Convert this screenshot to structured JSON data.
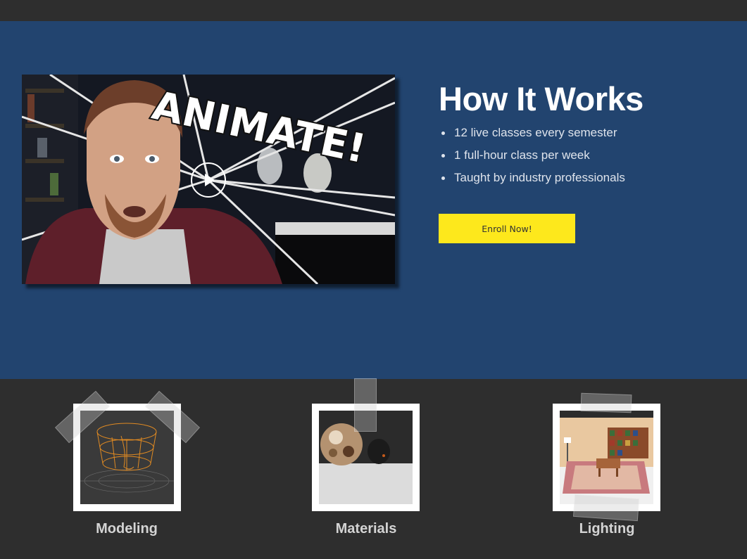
{
  "video": {
    "overlay_text": "ANIMATE!",
    "play_icon": "play-icon"
  },
  "how_it_works": {
    "title": "How It Works",
    "features": [
      "12 live classes every semester",
      "1 full-hour class per week",
      "Taught by industry professionals"
    ],
    "enroll_label": "Enroll Now!"
  },
  "gallery": [
    {
      "label": "Modeling"
    },
    {
      "label": "Materials"
    },
    {
      "label": "Lighting"
    }
  ],
  "colors": {
    "hero_background": "#22446f",
    "page_background": "#2e2e2e",
    "button": "#fde81c"
  }
}
